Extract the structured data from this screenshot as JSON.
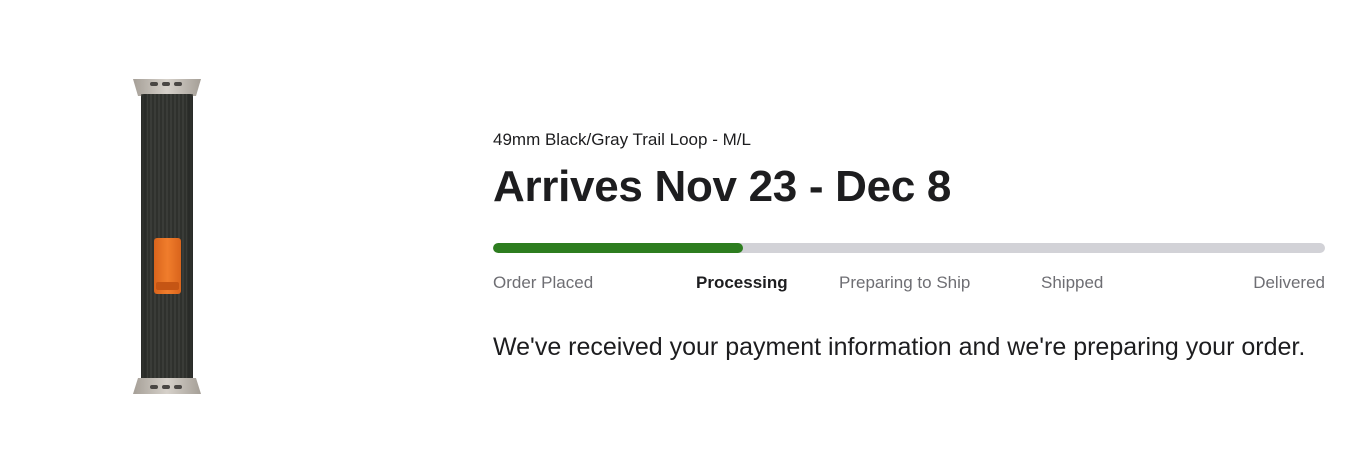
{
  "product": {
    "image_icon": "watch-band-image",
    "name": "49mm Black/Gray Trail Loop - M/L"
  },
  "delivery": {
    "arrival_text": "Arrives Nov 23 - Dec 8"
  },
  "progress": {
    "fraction_complete": 0.3,
    "fill_color": "#2d7d1f",
    "track_color": "#d2d2d7",
    "steps": [
      {
        "label": "Order Placed",
        "active": false
      },
      {
        "label": "Processing",
        "active": true
      },
      {
        "label": "Preparing to Ship",
        "active": false
      },
      {
        "label": "Shipped",
        "active": false
      },
      {
        "label": "Delivered",
        "active": false
      }
    ]
  },
  "status": {
    "message": "We've received your payment information and we're preparing your order."
  }
}
